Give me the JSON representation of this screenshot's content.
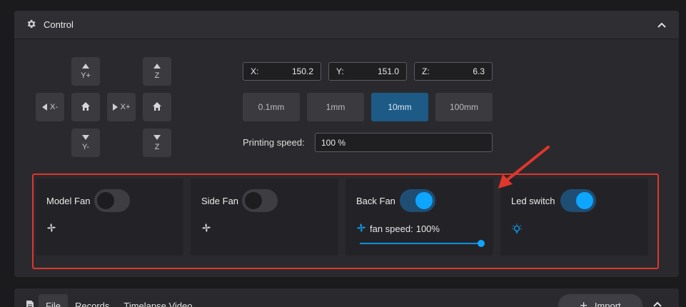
{
  "control": {
    "title": "Control",
    "icons": {
      "header": "gear-icon",
      "collapse": "chevron-up-icon"
    },
    "jog": {
      "y_plus": "Y+",
      "y_minus": "Y-",
      "x_minus": "X-",
      "x_plus": "X+",
      "z_up": "Z",
      "z_down": "Z",
      "home_icon": "home-icon"
    },
    "position": [
      {
        "label": "X:",
        "value": "150.2"
      },
      {
        "label": "Y:",
        "value": "151.0"
      },
      {
        "label": "Z:",
        "value": "6.3"
      }
    ],
    "steps": [
      "0.1mm",
      "1mm",
      "10mm",
      "100mm"
    ],
    "active_step": "10mm",
    "printing_speed": {
      "label": "Printing speed:",
      "value": "100 %"
    }
  },
  "fans": {
    "model_fan": {
      "label": "Model Fan",
      "on": false,
      "icon": "fan-icon"
    },
    "side_fan": {
      "label": "Side Fan",
      "on": false,
      "icon": "fan-icon"
    },
    "back_fan": {
      "label": "Back Fan",
      "on": true,
      "icon": "fan-icon",
      "speed_label": "fan speed:",
      "speed_value": "100%",
      "speed_fraction": 1.0
    },
    "led_switch": {
      "label": "Led switch",
      "on": true,
      "icon": "lightbulb-icon"
    }
  },
  "bottom": {
    "tabs": [
      "File",
      "Records",
      "Timelapse Video"
    ],
    "active_tab": "File",
    "import_label": "Import",
    "icons": {
      "file": "file-icon",
      "plus": "plus-icon",
      "collapse": "chevron-up-icon"
    }
  },
  "colors": {
    "accent": "#0ea5ff",
    "active_step_bg": "#1d5a85",
    "highlight_border": "#e0362b",
    "panel_bg": "#2a2a2e"
  }
}
